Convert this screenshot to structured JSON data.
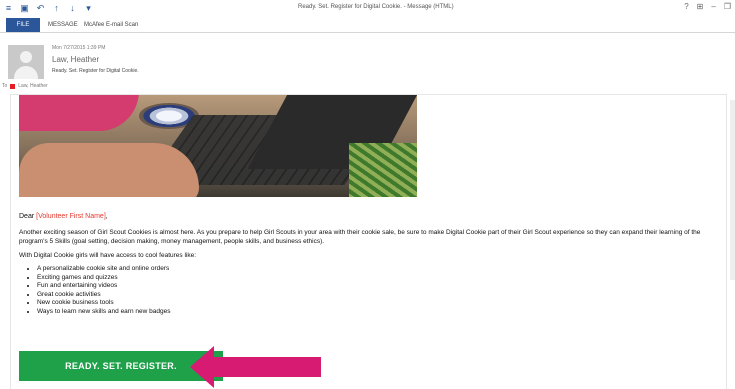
{
  "window": {
    "title": "Ready. Set. Register for Digital Cookie. - Message (HTML)",
    "quick_access": [
      "≡",
      "▣",
      "↶",
      "↑",
      "↓",
      "▾"
    ],
    "controls": [
      "?",
      "⊞",
      "–",
      "❐"
    ]
  },
  "ribbon": {
    "tabs": [
      "FILE",
      "MESSAGE",
      "McAfee E-mail Scan"
    ]
  },
  "message": {
    "date": "Mon 7/27/2015 1:39 PM",
    "sender": "Law, Heather",
    "subject": "Ready. Set. Register for Digital Cookie.",
    "to_label": "To",
    "to_name": "Law, Heather"
  },
  "body": {
    "salutation_prefix": "Dear ",
    "merge_field": "[Volunteer First Name]",
    "salutation_suffix": ",",
    "paragraph": "Another exciting season of Girl Scout Cookies is almost here. As you prepare to help Girl Scouts in your area with their cookie sale, be sure to make Digital Cookie part of their Girl Scout experience so they can expand their learning of the program's 5 Skills (goal setting, decision making, money management, people skills, and business ethics).",
    "intro": "With Digital Cookie girls will have access to cool features like:",
    "features": [
      "A personalizable cookie site and online orders",
      "Exciting games and quizzes",
      "Fun and entertaining videos",
      "Great cookie activities",
      "New cookie business tools",
      "Ways to learn new skills and earn new badges"
    ],
    "cta_label": "READY. SET. REGISTER."
  },
  "colors": {
    "accent": "#2b579a",
    "merge_field": "#e03a2f",
    "cta": "#1fa14a",
    "arrow": "#d81b72"
  }
}
